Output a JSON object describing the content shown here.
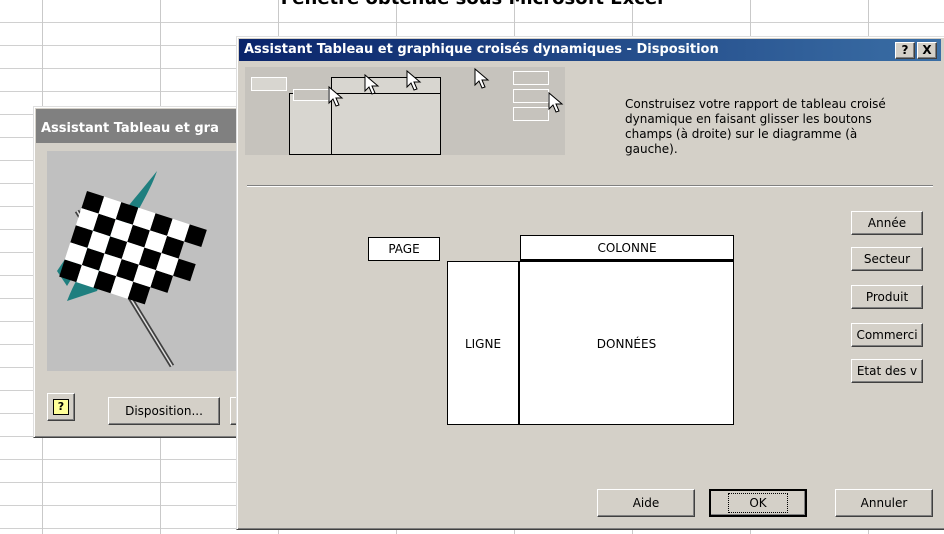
{
  "page_heading": "Fenêtre obtenue sous Microsoft Excel",
  "back_dialog": {
    "title": "Assistant Tableau et gra",
    "help_icon_char": "?",
    "disposition_button": "Disposition..."
  },
  "dialog": {
    "title": "Assistant Tableau et graphique croisés dynamiques - Disposition",
    "help_btn": "?",
    "close_btn": "X",
    "instructions": "Construisez votre rapport de tableau croisé dynamique en faisant glisser les boutons champs (à droite) sur le diagramme (à gauche).",
    "layout": {
      "page": "PAGE",
      "column": "COLONNE",
      "row": "LIGNE",
      "data": "DONNÉES"
    },
    "fields": [
      "Année",
      "Secteur",
      "Produit",
      "Commerci",
      "Etat des v"
    ],
    "buttons": {
      "help": "Aide",
      "ok": "OK",
      "cancel": "Annuler"
    }
  }
}
